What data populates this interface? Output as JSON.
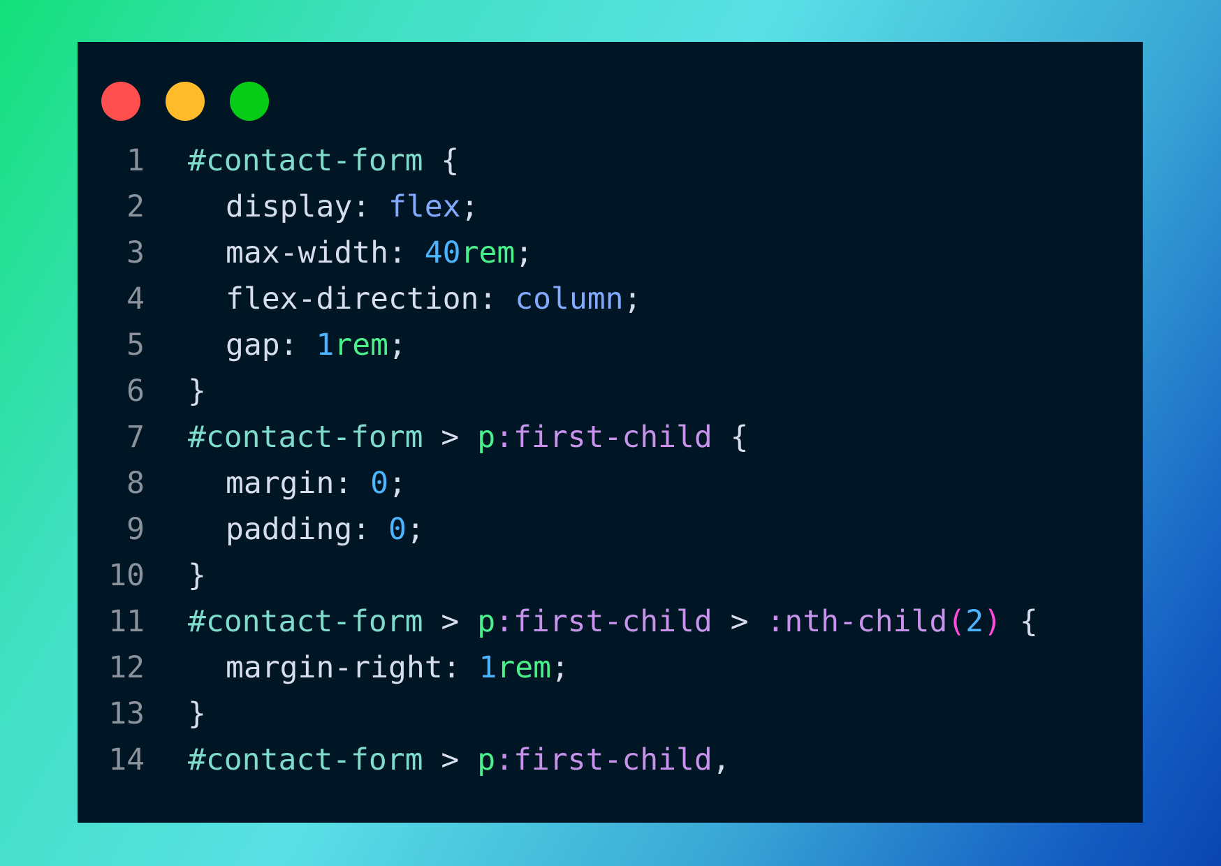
{
  "window": {
    "traffic_lights": [
      {
        "name": "close",
        "color": "#ff4f4f"
      },
      {
        "name": "minimize",
        "color": "#ffbb2a"
      },
      {
        "name": "zoom",
        "color": "#06cc18"
      }
    ]
  },
  "code": {
    "lines": [
      {
        "n": "1",
        "t": [
          "#contact-form",
          " {"
        ]
      },
      {
        "n": "2",
        "t": [
          "display",
          ": ",
          "flex",
          ";"
        ]
      },
      {
        "n": "3",
        "t": [
          "max-width",
          ": ",
          "40",
          "rem",
          ";"
        ]
      },
      {
        "n": "4",
        "t": [
          "flex-direction",
          ": ",
          "column",
          ";"
        ]
      },
      {
        "n": "5",
        "t": [
          "gap",
          ": ",
          "1",
          "rem",
          ";"
        ]
      },
      {
        "n": "6",
        "t": [
          "}"
        ]
      },
      {
        "n": "7",
        "t": [
          "#contact-form",
          " > ",
          "p",
          ":first-child",
          " {"
        ]
      },
      {
        "n": "8",
        "t": [
          "margin",
          ": ",
          "0",
          ";"
        ]
      },
      {
        "n": "9",
        "t": [
          "padding",
          ": ",
          "0",
          ";"
        ]
      },
      {
        "n": "10",
        "t": [
          "}"
        ]
      },
      {
        "n": "11",
        "t": [
          "#contact-form",
          " > ",
          "p",
          ":first-child",
          " > ",
          ":nth-child",
          "(",
          "2",
          ")",
          " {"
        ]
      },
      {
        "n": "12",
        "t": [
          "margin-right",
          ": ",
          "1",
          "rem",
          ";"
        ]
      },
      {
        "n": "13",
        "t": [
          "}"
        ]
      },
      {
        "n": "14",
        "t": [
          "#contact-form",
          " > ",
          "p",
          ":first-child",
          ","
        ]
      }
    ]
  }
}
